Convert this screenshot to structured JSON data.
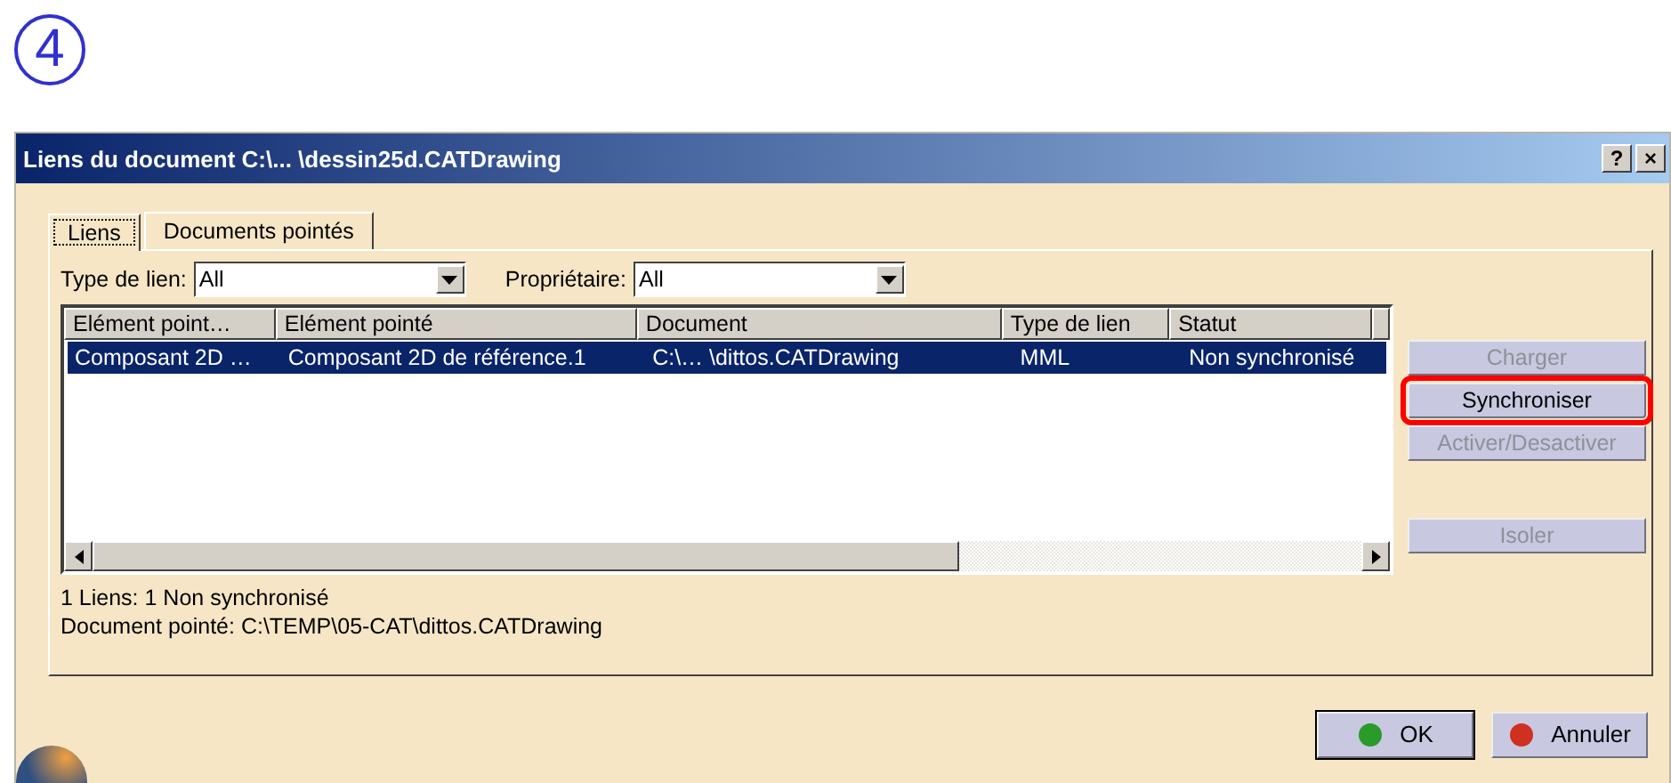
{
  "step_number": "4",
  "window": {
    "title": "Liens du document C:\\... \\dessin25d.CATDrawing",
    "title_buttons": [
      "?",
      "×"
    ]
  },
  "tabs": [
    {
      "label": "Liens",
      "selected": true
    },
    {
      "label": "Documents pointés",
      "selected": false
    }
  ],
  "filters": [
    {
      "label": "Type de lien:",
      "value": "All"
    },
    {
      "label": "Propriétaire:",
      "value": "All"
    }
  ],
  "table": {
    "columns": [
      "Elément point…",
      "Elément pointé",
      "Document",
      "Type de lien",
      "Statut"
    ],
    "rows": [
      {
        "selected": true,
        "cells": [
          "Composant 2D …",
          "Composant 2D de référence.1",
          "C:\\… \\dittos.CATDrawing",
          "MML",
          "Non synchronisé"
        ]
      }
    ]
  },
  "side_buttons": [
    {
      "label": "Charger",
      "disabled": true,
      "highlighted": false
    },
    {
      "label": "Synchroniser",
      "disabled": false,
      "highlighted": true
    },
    {
      "label": "Activer/Desactiver",
      "disabled": true,
      "highlighted": false
    },
    {
      "label": "Isoler",
      "disabled": true,
      "highlighted": false
    }
  ],
  "status_lines": [
    "1 Liens: 1 Non synchronisé",
    "Document pointé: C:\\TEMP\\05-CAT\\dittos.CATDrawing"
  ],
  "dialog_buttons": [
    {
      "label": "OK",
      "kind": "ok",
      "default": true
    },
    {
      "label": "Annuler",
      "kind": "cancel",
      "default": false
    }
  ]
}
